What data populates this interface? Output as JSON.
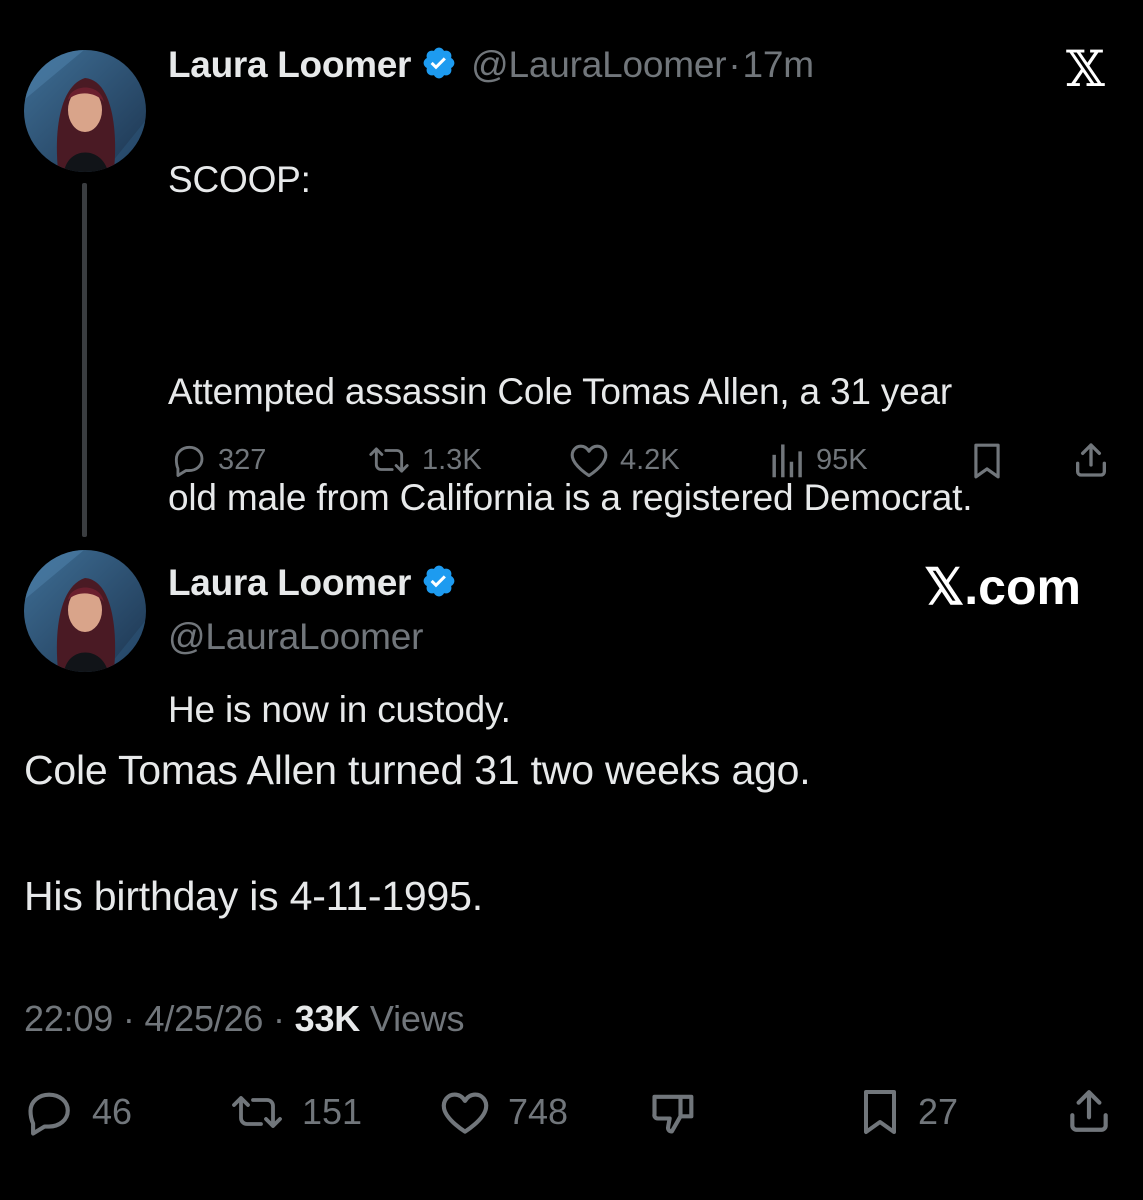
{
  "quoted_tweet": {
    "author_name": "Laura Loomer",
    "author_handle": "@LauraLoomer",
    "separator": "·",
    "time_ago": "17m",
    "logo_text": "𝕏",
    "text_lines": [
      "SCOOP:",
      "Attempted assassin Cole Tomas Allen, a 31 year",
      "old male from California is a registered Democrat.",
      "He is now in custody."
    ],
    "actions": {
      "replies": "327",
      "reposts": "1.3K",
      "likes": "4.2K",
      "views": "95K"
    }
  },
  "main_tweet": {
    "author_name": "Laura Loomer",
    "author_handle": "@LauraLoomer",
    "site_logo": "𝕏.com",
    "text_lines": [
      "Cole Tomas Allen turned 31 two weeks ago.",
      "His birthday is 4-11-1995."
    ],
    "time": "22:09",
    "date": "4/25/26",
    "separator": "·",
    "views_count": "33K",
    "views_label": "Views",
    "actions": {
      "replies": "46",
      "reposts": "151",
      "likes": "748",
      "bookmarks": "27"
    }
  },
  "colors": {
    "background": "#000000",
    "text_primary": "#e7e9ea",
    "text_secondary": "#71767b",
    "verified_blue": "#1d9bf0"
  },
  "icons": [
    "reply-icon",
    "repost-icon",
    "like-icon",
    "views-icon",
    "bookmark-icon",
    "share-icon",
    "dislike-icon",
    "verified-badge-icon"
  ]
}
